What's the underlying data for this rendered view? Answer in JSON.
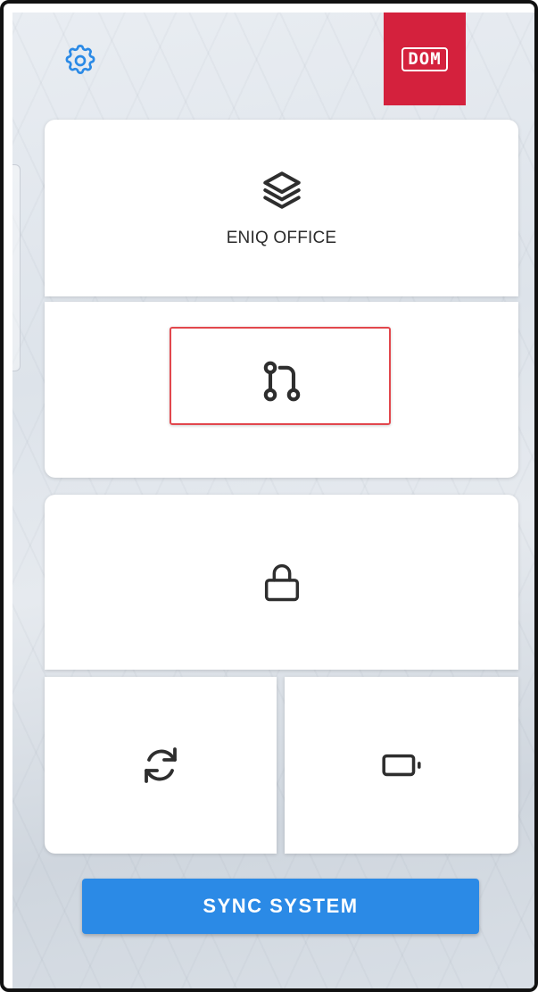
{
  "header": {
    "settings_icon": "gear-icon",
    "brand_logo_text": "DOM",
    "brand_color": "#d4213d"
  },
  "tiles": {
    "office": {
      "icon": "layers-icon",
      "label": "ENIQ OFFICE"
    },
    "flow": {
      "icon": "git-branch-icon",
      "highlighted": true,
      "highlight_color": "#e2474d"
    },
    "lock": {
      "icon": "lock-icon"
    },
    "sync": {
      "icon": "refresh-icon"
    },
    "device": {
      "icon": "battery-icon"
    }
  },
  "actions": {
    "sync_label": "SYNC SYSTEM",
    "sync_color": "#2b8ae6"
  },
  "theme": {
    "accent": "#2b8ae6",
    "icon_color": "#2e2e2e"
  }
}
